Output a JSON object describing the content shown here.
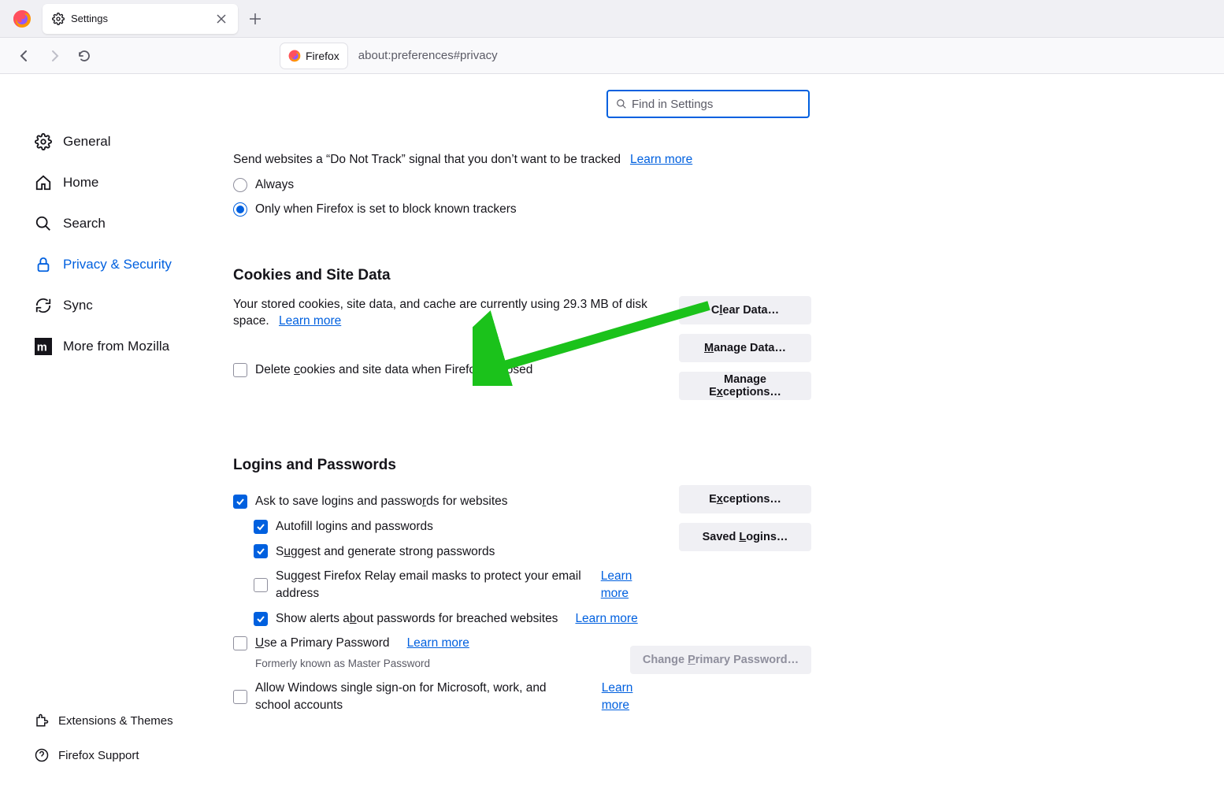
{
  "tab": {
    "title": "Settings"
  },
  "url": {
    "label": "Firefox",
    "address": "about:preferences#privacy"
  },
  "search": {
    "placeholder": "Find in Settings"
  },
  "sidebar": {
    "items": [
      {
        "label": "General"
      },
      {
        "label": "Home"
      },
      {
        "label": "Search"
      },
      {
        "label": "Privacy & Security"
      },
      {
        "label": "Sync"
      },
      {
        "label": "More from Mozilla"
      }
    ],
    "footer": [
      {
        "label": "Extensions & Themes"
      },
      {
        "label": "Firefox Support"
      }
    ]
  },
  "dnt": {
    "text": "Send websites a “Do Not Track” signal that you don’t want to be tracked",
    "learn": "Learn more",
    "always": "Always",
    "only": "Only when Firefox is set to block known trackers"
  },
  "cookies": {
    "title": "Cookies and Site Data",
    "usage": "Your stored cookies, site data, and cache are currently using 29.3 MB of disk space.",
    "learn": "Learn more",
    "delete": "Delete cookies and site data when Firefox is closed",
    "clear": "Clear Data…",
    "manage": "Manage Data…",
    "exceptions": "Manage Exceptions…"
  },
  "logins": {
    "title": "Logins and Passwords",
    "ask": "Ask to save logins and passwords for websites",
    "autofill": "Autofill logins and passwords",
    "suggest": "Suggest and generate strong passwords",
    "relay": "Suggest Firefox Relay email masks to protect your email address",
    "relay_learn": "Learn more",
    "alerts": "Show alerts about passwords for breached websites",
    "alerts_learn": "Learn more",
    "primary": "Use a Primary Password",
    "primary_learn": "Learn more",
    "formerly": "Formerly known as Master Password",
    "win": "Allow Windows single sign-on for Microsoft, work, and school accounts",
    "win_learn": "Learn more",
    "exceptions_btn": "Exceptions…",
    "saved_btn": "Saved Logins…",
    "change_btn": "Change Primary Password…"
  }
}
